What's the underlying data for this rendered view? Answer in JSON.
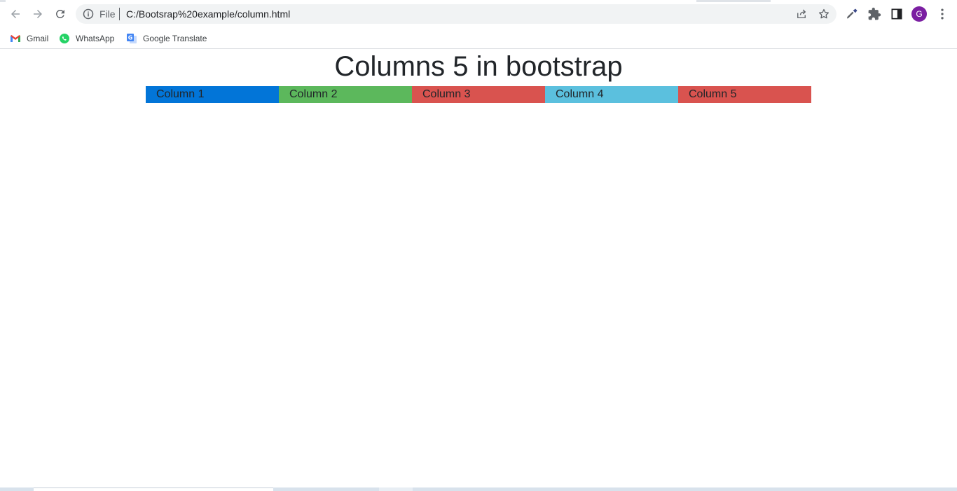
{
  "browser": {
    "scheme_label": "File",
    "url": "C:/Bootsrap%20example/column.html",
    "avatar_letter": "G",
    "avatar_color": "#7b1fa2"
  },
  "bookmarks": [
    {
      "label": "Gmail",
      "icon": "gmail-icon"
    },
    {
      "label": "WhatsApp",
      "icon": "whatsapp-icon"
    },
    {
      "label": "Google Translate",
      "icon": "google-translate-icon"
    }
  ],
  "page": {
    "title": "Columns 5 in bootstrap",
    "columns": [
      {
        "label": "Column 1",
        "color": "#0275d8"
      },
      {
        "label": "Column 2",
        "color": "#5cb85c"
      },
      {
        "label": "Column 3",
        "color": "#d9534f"
      },
      {
        "label": "Column 4",
        "color": "#5bc0de"
      },
      {
        "label": "Column 5",
        "color": "#d9534f"
      }
    ]
  }
}
